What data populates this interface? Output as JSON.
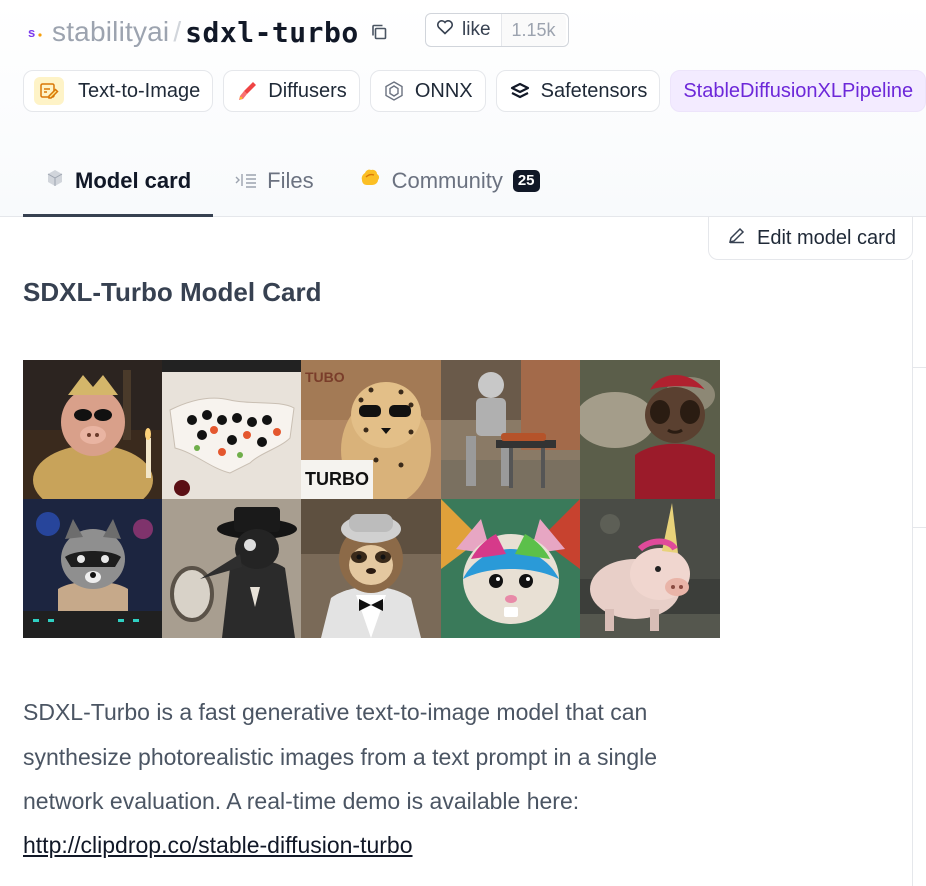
{
  "repo": {
    "org": "stabilityai",
    "separator": "/",
    "name": "sdxl-turbo",
    "like_label": "like",
    "like_count": "1.15k"
  },
  "tags": [
    {
      "label": "Text-to-Image",
      "icon": "text-to-image-icon"
    },
    {
      "label": "Diffusers",
      "icon": "diffusers-icon"
    },
    {
      "label": "ONNX",
      "icon": "onnx-icon"
    },
    {
      "label": "Safetensors",
      "icon": "safetensors-icon"
    },
    {
      "label": "StableDiffusionXLPipeline",
      "icon": ""
    }
  ],
  "tabs": [
    {
      "label": "Model card",
      "icon": "cube-icon",
      "active": true
    },
    {
      "label": "Files",
      "icon": "files-icon"
    },
    {
      "label": "Community",
      "icon": "community-icon",
      "badge": "25"
    }
  ],
  "edit_label": "Edit model card",
  "card": {
    "title": "SDXL-Turbo Model Card",
    "paragraph": "SDXL-Turbo is a fast generative text-to-image model that can synthesize photorealistic images from a text prompt in a single network evaluation. A real-time demo is available here:",
    "link": "http://clipdrop.co/stable-diffusion-turbo"
  },
  "gallery": {
    "turbo_text_1": "TURBO",
    "turbo_text_2": "TUBO",
    "turbo_text_3": "TURBO"
  },
  "colors": {
    "pipeline_bg": "#f3ebff",
    "pipeline_text": "#6d28d9",
    "badge_bg": "#111827"
  }
}
